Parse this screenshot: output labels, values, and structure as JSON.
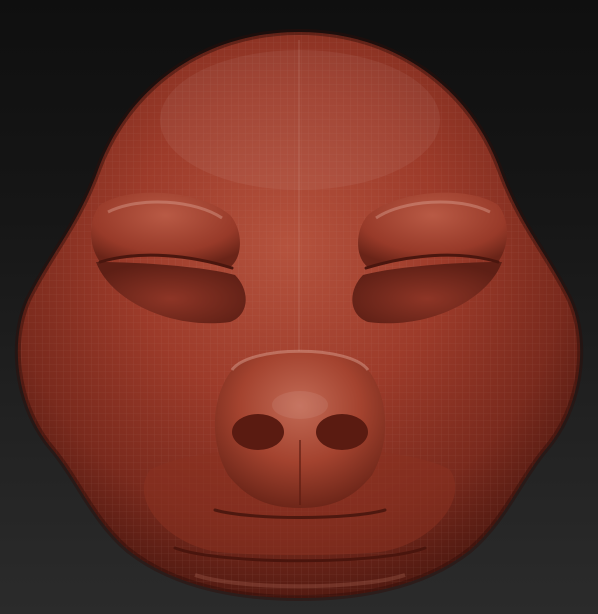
{
  "scene": {
    "subject": "head-sculpt",
    "material_color": "#a23d2c",
    "background_top": "#0f0f0f",
    "background_bottom": "#2b2b2b"
  }
}
